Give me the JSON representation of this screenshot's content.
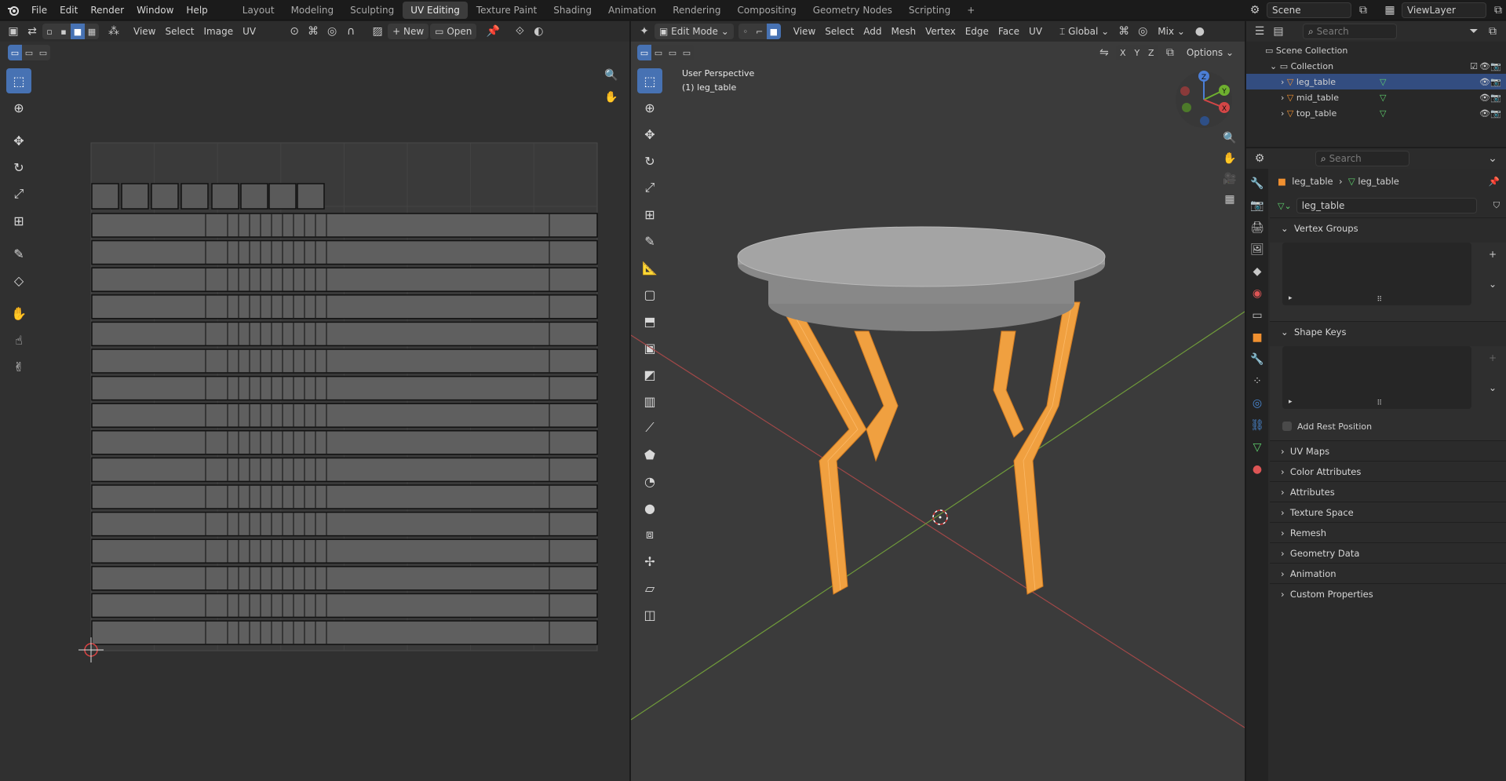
{
  "topbar": {
    "menus": [
      "File",
      "Edit",
      "Render",
      "Window",
      "Help"
    ],
    "workspaces": [
      "Layout",
      "Modeling",
      "Sculpting",
      "UV Editing",
      "Texture Paint",
      "Shading",
      "Animation",
      "Rendering",
      "Compositing",
      "Geometry Nodes",
      "Scripting"
    ],
    "active_workspace": "UV Editing",
    "add_workspace": "+",
    "scene": "Scene",
    "viewlayer": "ViewLayer"
  },
  "uv_editor": {
    "menus": [
      "View",
      "Select",
      "Image",
      "UV"
    ],
    "new_label": "New",
    "open_label": "Open"
  },
  "viewport": {
    "mode": "Edit Mode",
    "menus": [
      "View",
      "Select",
      "Add",
      "Mesh",
      "Vertex",
      "Edge",
      "Face",
      "UV"
    ],
    "transform_orientation": "Global",
    "proportional": "Mix",
    "axes": [
      "X",
      "Y",
      "Z"
    ],
    "options_label": "Options",
    "overlay_line1": "User Perspective",
    "overlay_line2": "(1) leg_table",
    "gizmo": {
      "x": "X",
      "y": "Y",
      "z": "Z"
    }
  },
  "outliner": {
    "search_placeholder": "Search",
    "scene_collection": "Scene Collection",
    "collection": "Collection",
    "objects": [
      "leg_table",
      "mid_table",
      "top_table"
    ],
    "selected": "leg_table"
  },
  "properties": {
    "search_placeholder": "Search",
    "breadcrumb_object": "leg_table",
    "breadcrumb_data": "leg_table",
    "mesh_name": "leg_table",
    "panels_open": [
      "Vertex Groups",
      "Shape Keys"
    ],
    "add_rest_position": "Add Rest Position",
    "panels_closed": [
      "UV Maps",
      "Color Attributes",
      "Attributes",
      "Texture Space",
      "Remesh",
      "Geometry Data",
      "Animation",
      "Custom Properties"
    ]
  },
  "colors": {
    "accent": "#4772b3",
    "selection_orange": "#f0a040",
    "background": "#303030",
    "header": "#2c2c2c"
  }
}
